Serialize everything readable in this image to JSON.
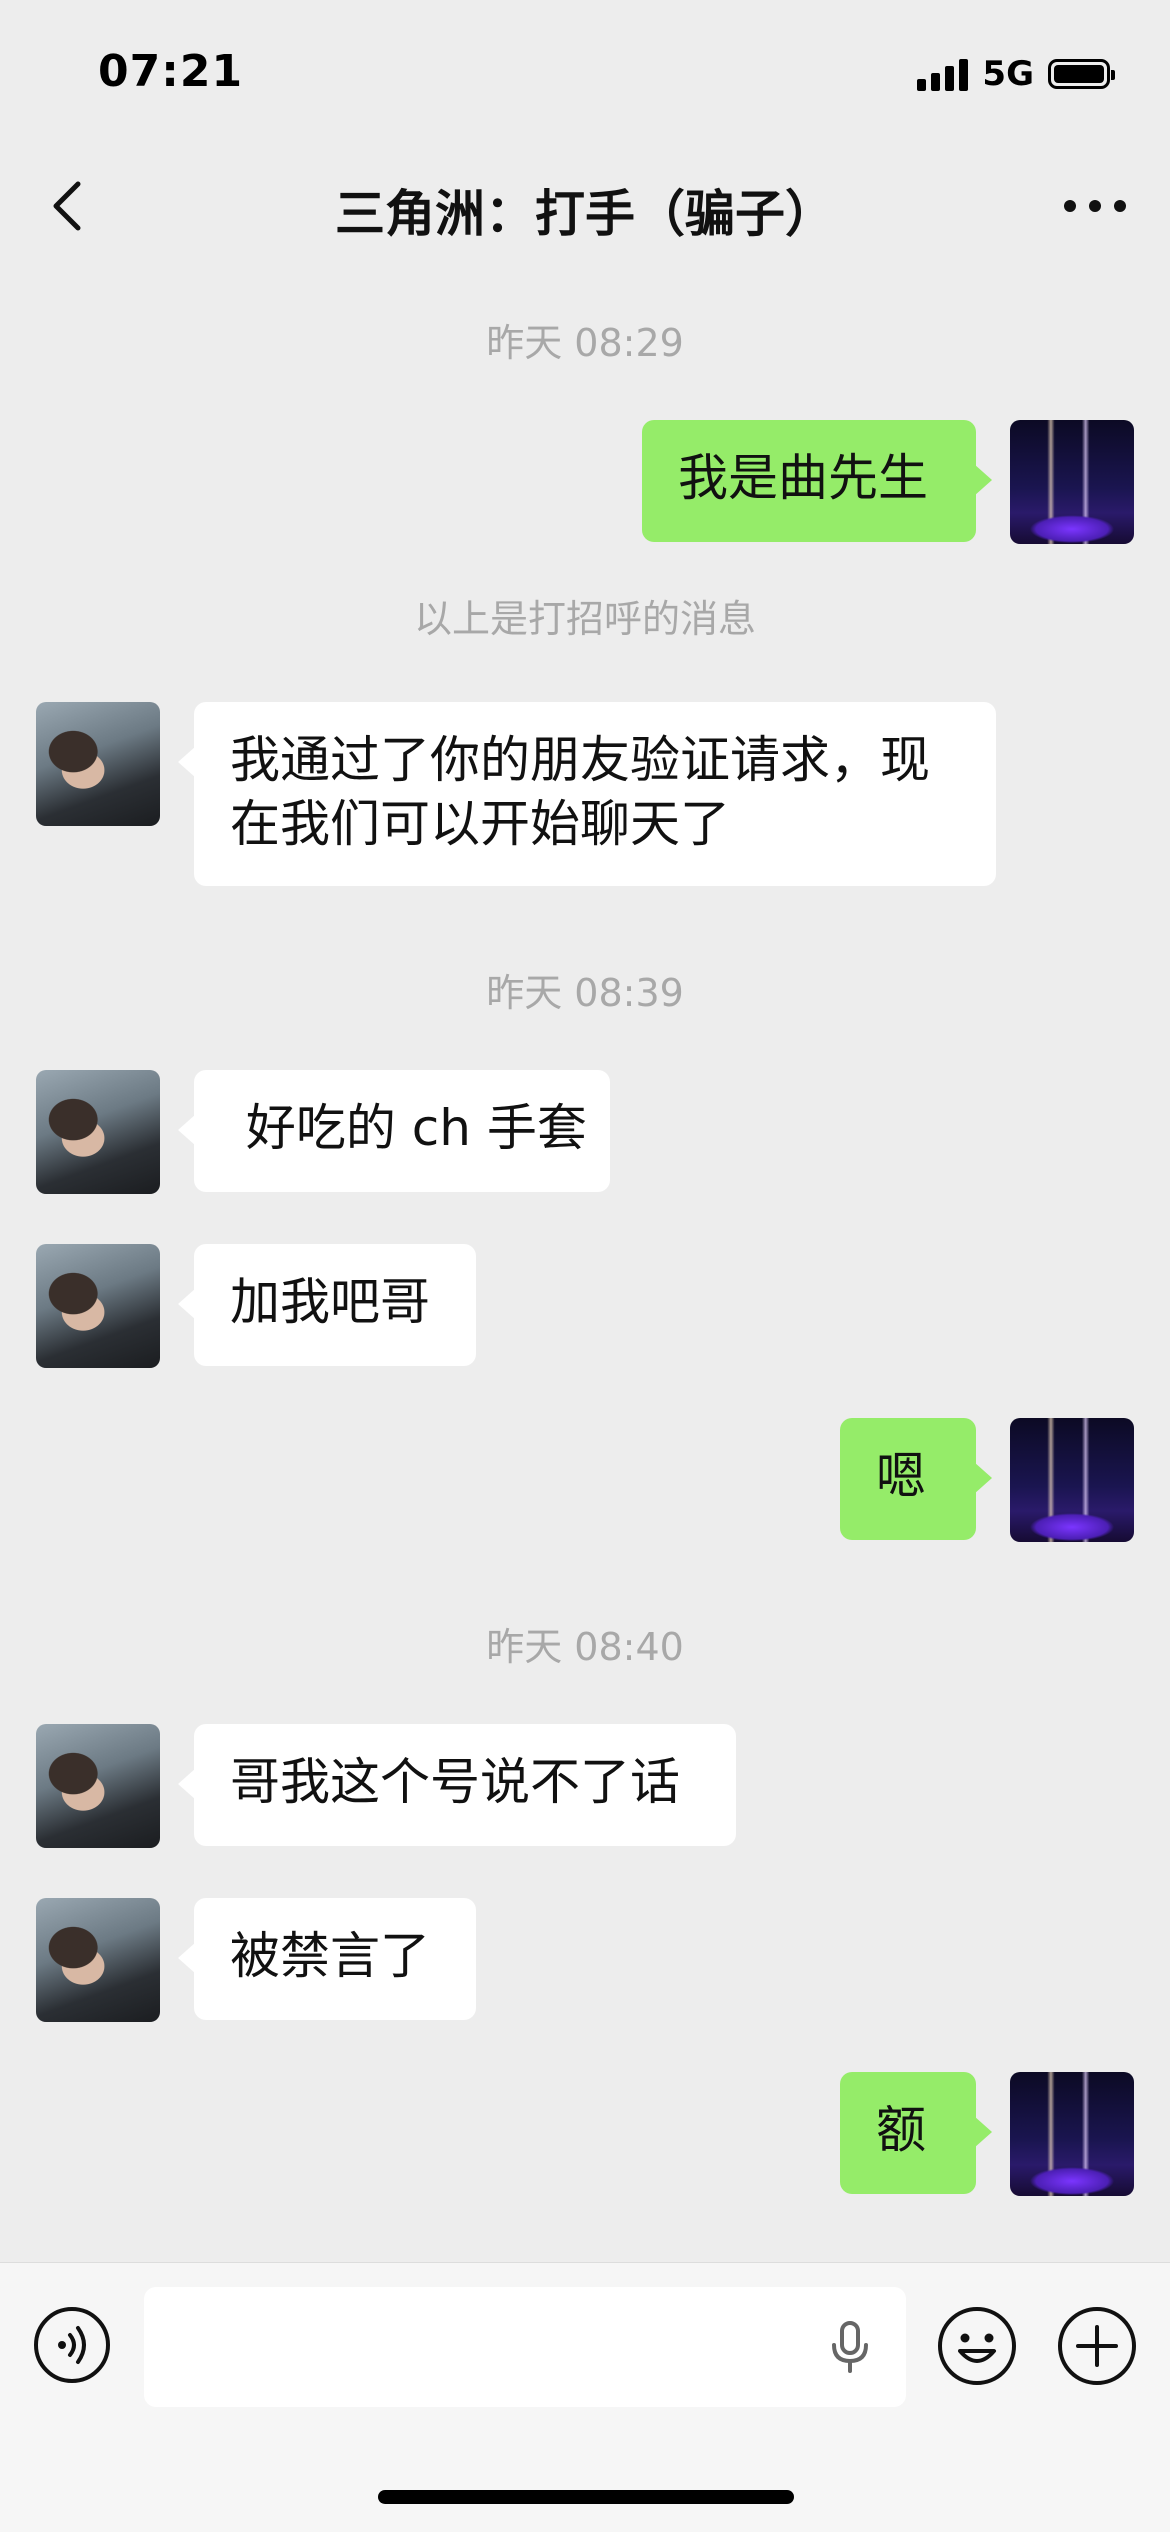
{
  "status_bar": {
    "time": "07:21",
    "network": "5G",
    "icons": [
      "signal-icon",
      "battery-icon"
    ]
  },
  "header": {
    "title": "三角洲：打手（骗子）",
    "back_icon": "chevron-left-icon",
    "more_icon": "more-dots-icon"
  },
  "messages": {
    "ts1": "昨天 08:29",
    "m1": "我是曲先生",
    "sys1": "以上是打招呼的消息",
    "m2": "我通过了你的朋友验证请求，现在我们可以开始聊天了",
    "ts2": "昨天 08:39",
    "m3": " 好吃的 ch 手套",
    "m4": "加我吧哥",
    "m5": "嗯",
    "ts3": "昨天 08:40",
    "m6": "哥我这个号说不了话",
    "m7": "被禁言了",
    "m8": "额"
  },
  "input_bar": {
    "icons": [
      "voice-icon",
      "microphone-icon",
      "emoji-icon",
      "plus-icon"
    ]
  },
  "colors": {
    "background": "#EDEDED",
    "self_bubble": "#95EC69",
    "other_bubble": "#FFFFFF",
    "timestamp_text": "#A8A8A8"
  }
}
